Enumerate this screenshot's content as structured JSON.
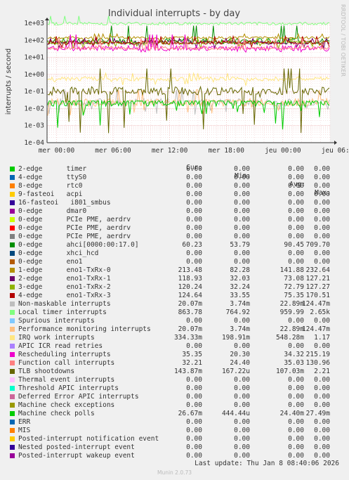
{
  "chart_data": {
    "type": "line",
    "title": "Individual interrupts - by day",
    "ylabel": "interrupts / second",
    "side_label": "RRDTOOL / TOBI OETIKER",
    "yscale": "log",
    "ylim": [
      0.0001,
      1000
    ],
    "y_ticks": [
      "1e+03",
      "1e+02",
      "1e+01",
      "1e+00",
      "1e-01",
      "1e-02",
      "1e-03",
      "1e-04"
    ],
    "x_ticks": [
      "mer 00:00",
      "mer 06:00",
      "mer 12:00",
      "mer 18:00",
      "jeu 00:00",
      "jeu 06:00"
    ],
    "grid": true,
    "columns": [
      "Cur:",
      "Min:",
      "Avg:",
      "Max:"
    ],
    "series": [
      {
        "name": "2-edge      timer",
        "color": "#00cc00",
        "cur": "0.00",
        "min": "0.00",
        "avg": "0.00",
        "max": "0.00"
      },
      {
        "name": "4-edge      ttyS0",
        "color": "#0066b3",
        "cur": "0.00",
        "min": "0.00",
        "avg": "0.00",
        "max": "0.00"
      },
      {
        "name": "8-edge      rtc0",
        "color": "#ff8000",
        "cur": "0.00",
        "min": "0.00",
        "avg": "0.00",
        "max": "0.00"
      },
      {
        "name": "9-fasteoi   acpi",
        "color": "#ffcc00",
        "cur": "0.00",
        "min": "0.00",
        "avg": "0.00",
        "max": "0.00"
      },
      {
        "name": "16-fasteoi   i801_smbus",
        "color": "#330099",
        "cur": "0.00",
        "min": "0.00",
        "avg": "0.00",
        "max": "0.00"
      },
      {
        "name": "0-edge      dmar0",
        "color": "#990099",
        "cur": "0.00",
        "min": "0.00",
        "avg": "0.00",
        "max": "0.00"
      },
      {
        "name": "0-edge      PCIe PME, aerdrv",
        "color": "#ccff00",
        "cur": "0.00",
        "min": "0.00",
        "avg": "0.00",
        "max": "0.00"
      },
      {
        "name": "0-edge      PCIe PME, aerdrv",
        "color": "#ff0000",
        "cur": "0.00",
        "min": "0.00",
        "avg": "0.00",
        "max": "0.00"
      },
      {
        "name": "0-edge      PCIe PME, aerdrv",
        "color": "#808080",
        "cur": "0.00",
        "min": "0.00",
        "avg": "0.00",
        "max": "0.00"
      },
      {
        "name": "0-edge      ahci[0000:00:17.0]",
        "color": "#008f00",
        "cur": "60.23",
        "min": "53.79",
        "avg": "90.45",
        "max": "709.70"
      },
      {
        "name": "0-edge      xhci_hcd",
        "color": "#00487d",
        "cur": "0.00",
        "min": "0.00",
        "avg": "0.00",
        "max": "0.00"
      },
      {
        "name": "0-edge      eno1",
        "color": "#b35a00",
        "cur": "0.00",
        "min": "0.00",
        "avg": "0.00",
        "max": "0.00"
      },
      {
        "name": "1-edge      eno1-TxRx-0",
        "color": "#b38f00",
        "cur": "213.48",
        "min": "82.28",
        "avg": "141.88",
        "max": "232.64"
      },
      {
        "name": "2-edge      eno1-TxRx-1",
        "color": "#6b006b",
        "cur": "118.93",
        "min": "32.03",
        "avg": "73.08",
        "max": "127.21"
      },
      {
        "name": "3-edge      eno1-TxRx-2",
        "color": "#8fb300",
        "cur": "120.24",
        "min": "32.24",
        "avg": "72.79",
        "max": "127.27"
      },
      {
        "name": "4-edge      eno1-TxRx-3",
        "color": "#b30000",
        "cur": "124.64",
        "min": "33.55",
        "avg": "75.35",
        "max": "170.51"
      },
      {
        "name": "Non-maskable interrupts",
        "color": "#bebebe",
        "cur": "20.07m",
        "min": "3.74m",
        "avg": "22.89m",
        "max": "124.47m"
      },
      {
        "name": "Local timer interrupts",
        "color": "#80ff80",
        "cur": "863.78",
        "min": "764.92",
        "avg": "959.99",
        "max": "2.65k"
      },
      {
        "name": "Spurious interrupts",
        "color": "#80c9ff",
        "cur": "0.00",
        "min": "0.00",
        "avg": "0.00",
        "max": "0.00"
      },
      {
        "name": "Performance monitoring interrupts",
        "color": "#ffc080",
        "cur": "20.07m",
        "min": "3.74m",
        "avg": "22.89m",
        "max": "124.47m"
      },
      {
        "name": "IRQ work interrupts",
        "color": "#ffe680",
        "cur": "334.33m",
        "min": "198.91m",
        "avg": "548.28m",
        "max": "1.17"
      },
      {
        "name": "APIC ICR read retries",
        "color": "#aa80ff",
        "cur": "0.00",
        "min": "0.00",
        "avg": "0.00",
        "max": "0.00"
      },
      {
        "name": "Rescheduling interrupts",
        "color": "#ee00cc",
        "cur": "35.35",
        "min": "20.30",
        "avg": "34.32",
        "max": "215.19"
      },
      {
        "name": "Function call interrupts",
        "color": "#ff8080",
        "cur": "32.21",
        "min": "24.40",
        "avg": "35.03",
        "max": "130.96"
      },
      {
        "name": "TLB shootdowns",
        "color": "#666600",
        "cur": "143.87m",
        "min": "167.22u",
        "avg": "107.03m",
        "max": "2.21"
      },
      {
        "name": "Thermal event interrupts",
        "color": "#ffbfff",
        "cur": "0.00",
        "min": "0.00",
        "avg": "0.00",
        "max": "0.00"
      },
      {
        "name": "Threshold APIC interrupts",
        "color": "#00ffcc",
        "cur": "0.00",
        "min": "0.00",
        "avg": "0.00",
        "max": "0.00"
      },
      {
        "name": "Deferred Error APIC interrupts",
        "color": "#cc6699",
        "cur": "0.00",
        "min": "0.00",
        "avg": "0.00",
        "max": "0.00"
      },
      {
        "name": "Machine check exceptions",
        "color": "#999900",
        "cur": "0.00",
        "min": "0.00",
        "avg": "0.00",
        "max": "0.00"
      },
      {
        "name": "Machine check polls",
        "color": "#00cc00",
        "cur": "26.67m",
        "min": "444.44u",
        "avg": "24.40m",
        "max": "27.49m"
      },
      {
        "name": "ERR",
        "color": "#0066b3",
        "cur": "0.00",
        "min": "0.00",
        "avg": "0.00",
        "max": "0.00"
      },
      {
        "name": "MIS",
        "color": "#ff8000",
        "cur": "0.00",
        "min": "0.00",
        "avg": "0.00",
        "max": "0.00"
      },
      {
        "name": "Posted-interrupt notification event",
        "color": "#ffcc00",
        "cur": "0.00",
        "min": "0.00",
        "avg": "0.00",
        "max": "0.00"
      },
      {
        "name": "Nested posted-interrupt event",
        "color": "#330099",
        "cur": "0.00",
        "min": "0.00",
        "avg": "0.00",
        "max": "0.00"
      },
      {
        "name": "Posted-interrupt wakeup event",
        "color": "#990099",
        "cur": "0.00",
        "min": "0.00",
        "avg": "0.00",
        "max": "0.00"
      }
    ],
    "last_update": "Last update: Thu Jan  8 08:40:06 2026",
    "footer": "Munin 2.0.73"
  }
}
